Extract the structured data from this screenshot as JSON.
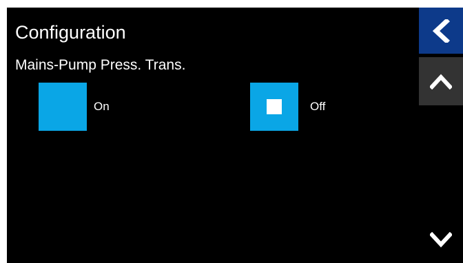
{
  "header": {
    "title": "Configuration",
    "subtitle": "Mains-Pump Press. Trans."
  },
  "options": {
    "on": {
      "label": "On",
      "selected": false
    },
    "off": {
      "label": "Off",
      "selected": true
    }
  },
  "nav": {
    "back_icon": "chevron-left-icon",
    "up_icon": "chevron-up-icon",
    "down_icon": "chevron-down-icon"
  },
  "colors": {
    "background": "#000000",
    "option_box": "#0aa6e6",
    "back_button": "#0d3a8a",
    "up_button": "#333333",
    "text": "#ffffff"
  }
}
